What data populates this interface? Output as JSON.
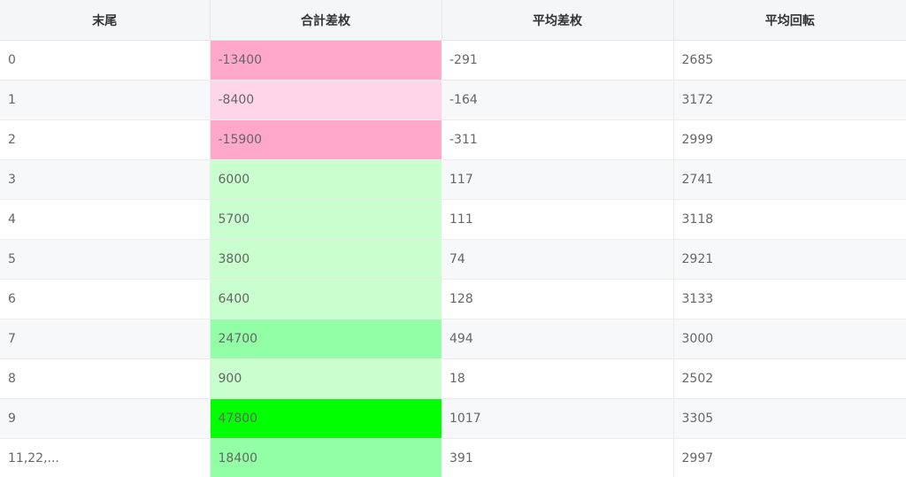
{
  "headers": [
    "末尾",
    "合計差枚",
    "平均差枚",
    "平均回転"
  ],
  "rows": [
    {
      "tail": "0",
      "total": "-13400",
      "avg_diff": "-291",
      "avg_spin": "2685",
      "color": "red"
    },
    {
      "tail": "1",
      "total": "-8400",
      "avg_diff": "-164",
      "avg_spin": "3172",
      "color": "pink"
    },
    {
      "tail": "2",
      "total": "-15900",
      "avg_diff": "-311",
      "avg_spin": "2999",
      "color": "red"
    },
    {
      "tail": "3",
      "total": "6000",
      "avg_diff": "117",
      "avg_spin": "2741",
      "color": "lightgreen"
    },
    {
      "tail": "4",
      "total": "5700",
      "avg_diff": "111",
      "avg_spin": "3118",
      "color": "lightgreen"
    },
    {
      "tail": "5",
      "total": "3800",
      "avg_diff": "74",
      "avg_spin": "2921",
      "color": "lightgreen"
    },
    {
      "tail": "6",
      "total": "6400",
      "avg_diff": "128",
      "avg_spin": "3133",
      "color": "lightgreen"
    },
    {
      "tail": "7",
      "total": "24700",
      "avg_diff": "494",
      "avg_spin": "3000",
      "color": "midgreen"
    },
    {
      "tail": "8",
      "total": "900",
      "avg_diff": "18",
      "avg_spin": "2502",
      "color": "lightgreen"
    },
    {
      "tail": "9",
      "total": "47800",
      "avg_diff": "1017",
      "avg_spin": "3305",
      "color": "green"
    },
    {
      "tail": "11,22,...",
      "total": "18400",
      "avg_diff": "391",
      "avg_spin": "2997",
      "color": "midgreen"
    }
  ],
  "colors": {
    "red": "#ffa8c9",
    "pink": "#ffd5ea",
    "lightgreen": "#c9fecf",
    "midgreen": "#92fea5",
    "green": "#00ff00",
    "header_bg": "#f5f6f8"
  }
}
